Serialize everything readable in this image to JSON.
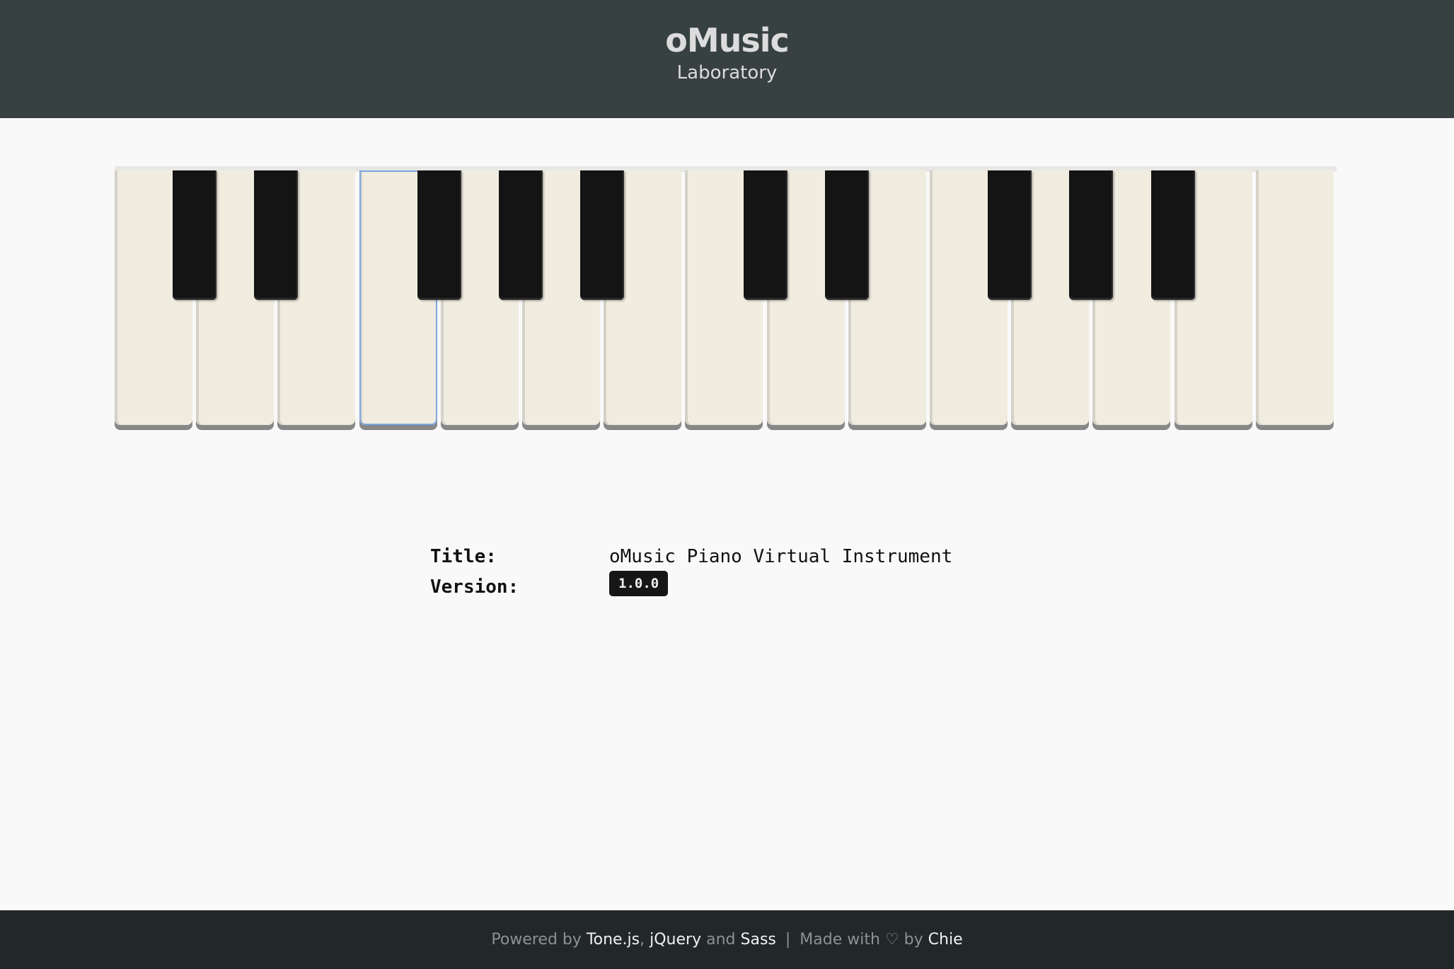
{
  "header": {
    "logo": "oMusic",
    "subtitle": "Laboratory"
  },
  "piano": {
    "white_keys": 15,
    "black_key_positions": [
      0,
      1,
      3,
      4,
      5,
      7,
      8,
      10,
      11,
      12
    ],
    "focused_white_key": 3
  },
  "info": {
    "title_label": "Title:",
    "title_value": "oMusic Piano Virtual Instrument",
    "version_label": "Version:",
    "version_value": "1.0.0"
  },
  "footer": {
    "powered_by": "Powered by",
    "tone_link": "Tone.js",
    "comma": ",",
    "jquery_link": "jQuery",
    "and": "and",
    "sass_link": "Sass",
    "separator": "|",
    "made_with": "Made with",
    "heart": "♡",
    "by": "by",
    "author_link": "Chie"
  }
}
